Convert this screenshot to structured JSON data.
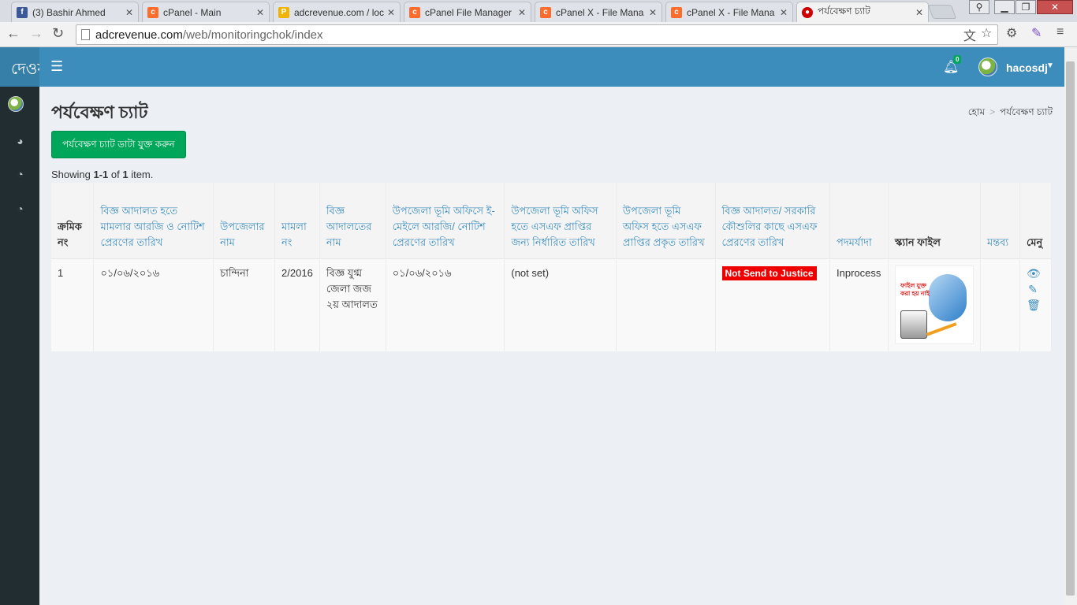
{
  "browser": {
    "tabs": [
      {
        "title": "(3) Bashir Ahmed",
        "fav": "facebook-icon",
        "color": "#3b5998"
      },
      {
        "title": "cPanel - Main",
        "fav": "cpanel-icon",
        "color": "#ff6c2c"
      },
      {
        "title": "adcrevenue.com / loc",
        "fav": "phpmyadmin-icon",
        "color": "#f0b400"
      },
      {
        "title": "cPanel File Manager",
        "fav": "cpanel-icon",
        "color": "#ff6c2c"
      },
      {
        "title": "cPanel X - File Mana",
        "fav": "cpanel-icon",
        "color": "#ff6c2c"
      },
      {
        "title": "cPanel X - File Mana",
        "fav": "cpanel-icon",
        "color": "#ff6c2c"
      },
      {
        "title": "পর্যবেক্ষণ চ্যাট",
        "fav": "bd-govt-icon",
        "color": "#c00"
      }
    ],
    "url_host": "adcrevenue.com",
    "url_path": "/web/monitoringchok/index"
  },
  "app": {
    "brand": "দেওয়া",
    "notification_count": "0",
    "user_name": "hacosdj"
  },
  "page": {
    "title": "পর্যবেক্ষণ চ্যাট",
    "breadcrumb_home": "হোম",
    "breadcrumb_current": "পর্যবেক্ষণ চ্যাট",
    "add_button": "পর্যবেক্ষণ চ্যাট ডাটা যুক্ত করুন",
    "summary_prefix": "Showing ",
    "summary_range": "1-1",
    "summary_mid": " of ",
    "summary_total": "1",
    "summary_suffix": " item."
  },
  "table": {
    "headers": [
      "ক্রমিক নং",
      "বিজ্ঞ আদালত হতে মামলার আরজি ও নোটিশ প্রেরণের তারিখ",
      "উপজেলার নাম",
      "মামলা নং",
      "বিজ্ঞ আদালতের নাম",
      "উপজেলা ভূমি অফিসে ই-মেইলে আরজি/ নোটিশ প্রেরণের তারিখ",
      "উপজেলা ভূমি অফিস হতে এসএফ প্রাপ্তির জন্য নির্ধারিত তারিখ",
      "উপজেলা ভূমি অফিস হতে এসএফ প্রাপ্তির প্রকৃত তারিখ",
      "বিজ্ঞ আদালত/ সরকারি কৌশুলির কাছে এসএফ প্রেরণের তারিখ",
      "পদমর্যাদা",
      "স্ক্যান ফাইল",
      "মন্তব্য",
      "মেনু"
    ],
    "rows": [
      {
        "serial": "1",
        "court_send_date": "০১/০৬/২০১৬",
        "upazila": "চান্দিনা",
        "case_no": "2/2016",
        "court_name": "বিজ্ঞ যুগ্ম জেলা জজ ২য় আদালত",
        "email_date": "০১/০৬/২০১৬",
        "sf_scheduled_date": "(not set)",
        "sf_actual_date": "",
        "sf_send_status": "Not Send to Justice",
        "rank": "Inprocess",
        "scan_caption": "ফাইল যুক্ত করা হয় নাই",
        "comment": ""
      }
    ]
  },
  "colors": {
    "header_blue": "#3c8dbc",
    "sidebar_dark": "#222d32",
    "button_green": "#00a65a",
    "badge_red": "#ee0000"
  }
}
